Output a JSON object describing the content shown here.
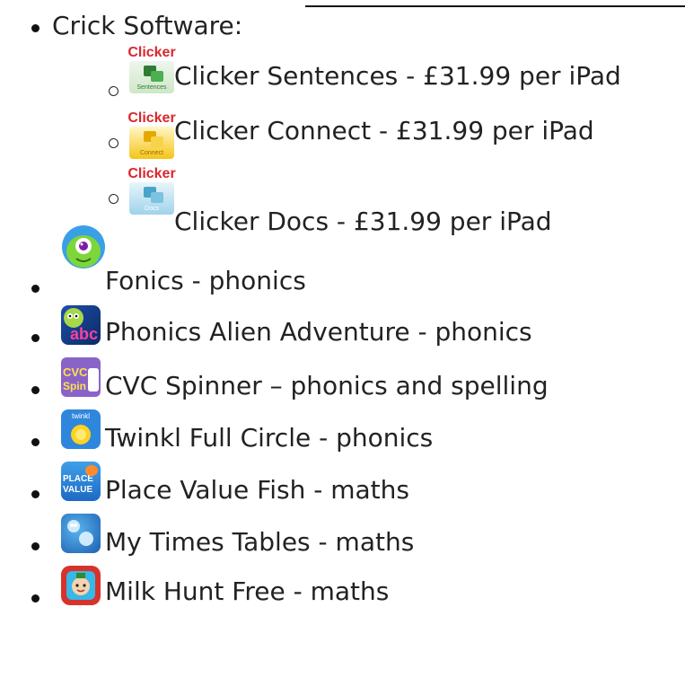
{
  "list": {
    "crick": {
      "label": "Crick Software:",
      "sub_items": [
        {
          "brand": "Clicker",
          "tag": "Sentences",
          "label": "Clicker Sentences - £31.99 per iPad"
        },
        {
          "brand": "Clicker",
          "tag": "Connect",
          "label": "Clicker Connect - £31.99 per iPad"
        },
        {
          "brand": "Clicker",
          "tag": "Docs",
          "label": "Clicker Docs - £31.99 per iPad"
        }
      ]
    },
    "apps": [
      {
        "label": "Fonics - phonics"
      },
      {
        "label": "Phonics Alien Adventure - phonics",
        "icon_text": "abc"
      },
      {
        "label": "CVC Spinner – phonics and spelling",
        "icon_text_1": "CVC",
        "icon_text_2": "Spin"
      },
      {
        "label": "Twinkl Full Circle - phonics",
        "icon_text": "twinkl"
      },
      {
        "label": "Place Value Fish - maths",
        "icon_text_1": "PLACE",
        "icon_text_2": "VALUE"
      },
      {
        "label": "My Times Tables - maths"
      },
      {
        "label": "Milk Hunt Free - maths"
      }
    ]
  },
  "colors": {
    "clicker_brand": "#d9272e",
    "sentences_tile": "#2e7d32",
    "connect_tile": "#f5c518",
    "docs_tile": "#4aa3c9"
  }
}
